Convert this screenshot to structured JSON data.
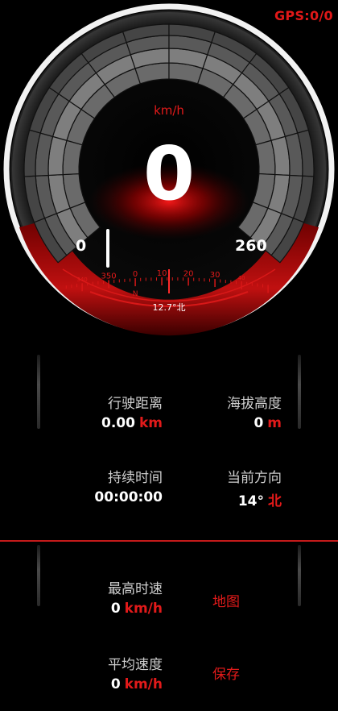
{
  "status": {
    "gps": "GPS:0/0"
  },
  "speedometer": {
    "unit": "km/h",
    "speed": "0",
    "min_label": "0",
    "max_label": "260",
    "needle_value": 0,
    "max_value": 260
  },
  "compass": {
    "ticks": [
      {
        "label": "340",
        "deg": 340
      },
      {
        "label": "350",
        "deg": 350
      },
      {
        "label": "0",
        "deg": 360
      },
      {
        "label": "10",
        "deg": 370
      },
      {
        "label": "20",
        "deg": 380
      },
      {
        "label": "30",
        "deg": 390
      },
      {
        "label": "40",
        "deg": 400
      }
    ],
    "north_marker": "N",
    "readout": "12.7°北",
    "heading_value": 12.7
  },
  "stats": {
    "distance": {
      "label": "行驶距离",
      "value": "0.00",
      "unit": "km"
    },
    "altitude": {
      "label": "海拔高度",
      "value": "0",
      "unit": "m"
    },
    "duration": {
      "label": "持续时间",
      "value": "00:00:00"
    },
    "direction": {
      "label": "当前方向",
      "value": "14°",
      "unit": "北"
    },
    "max_speed": {
      "label": "最高时速",
      "value": "0",
      "unit": "km/h"
    },
    "avg_speed": {
      "label": "平均速度",
      "value": "0",
      "unit": "km/h"
    }
  },
  "actions": {
    "map": "地图",
    "save": "保存"
  },
  "colors": {
    "accent": "#e21a1a",
    "background": "#000000",
    "text": "#ffffff"
  }
}
